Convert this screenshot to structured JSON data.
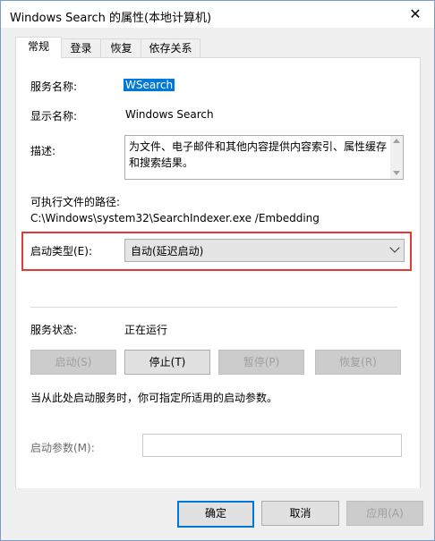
{
  "window": {
    "title": "Windows Search 的属性(本地计算机)"
  },
  "tabs": [
    "常规",
    "登录",
    "恢复",
    "依存关系"
  ],
  "general": {
    "service_name_label": "服务名称:",
    "service_name_value": "WSearch",
    "display_name_label": "显示名称:",
    "display_name_value": "Windows Search",
    "description_label": "描述:",
    "description_value": "为文件、电子邮件和其他内容提供内容索引、属性缓存和搜索结果。",
    "exec_path_label": "可执行文件的路径:",
    "exec_path_value": "C:\\Windows\\system32\\SearchIndexer.exe /Embedding",
    "startup_type_label": "启动类型(E):",
    "startup_type_value": "自动(延迟启动)",
    "service_status_label": "服务状态:",
    "service_status_value": "正在运行",
    "start_btn": "启动(S)",
    "stop_btn": "停止(T)",
    "pause_btn": "暂停(P)",
    "resume_btn": "恢复(R)",
    "hint": "当从此处启动服务时，你可指定所适用的启动参数。",
    "start_params_label": "启动参数(M):",
    "start_params_value": ""
  },
  "footer": {
    "ok": "确定",
    "cancel": "取消",
    "apply": "应用(A)"
  },
  "colors": {
    "highlight": "#e53935",
    "selection": "#0078d7"
  }
}
